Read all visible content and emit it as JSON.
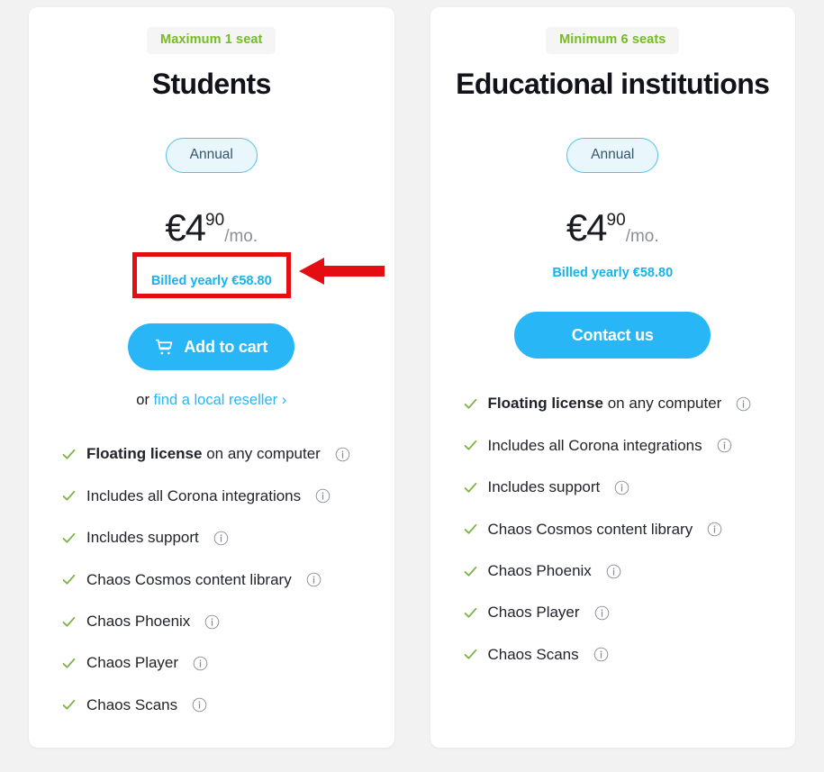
{
  "theme": {
    "page_bg": "#f2f2f2",
    "card_bg": "#ffffff",
    "accent_blue": "#29b6f6",
    "link_blue": "#17b3ec",
    "badge_green": "#76bc21",
    "check_green": "#7cb342",
    "annotation_red": "#e40d12",
    "title_color": "#12131a"
  },
  "plans": [
    {
      "id": "students",
      "badge": "Maximum 1 seat",
      "title": "Students",
      "term": "Annual",
      "price": {
        "currency_amount": "€4",
        "cents": "90",
        "period": "/mo."
      },
      "billed_note": "Billed yearly €58.80",
      "billed_highlighted": true,
      "cta": {
        "label": "Add to cart",
        "icon": "shopping-cart-icon",
        "has_icon": true
      },
      "reseller": {
        "prefix": "or",
        "link_label": "find a local reseller",
        "chevron": "›"
      },
      "features": [
        {
          "bold": "Floating license",
          "rest": " on any computer",
          "info": "info-icon"
        },
        {
          "bold": "",
          "rest": "Includes all Corona integrations",
          "info": "info-icon"
        },
        {
          "bold": "",
          "rest": "Includes support",
          "info": "info-icon"
        },
        {
          "bold": "",
          "rest": "Chaos Cosmos content library",
          "info": "info-icon"
        },
        {
          "bold": "",
          "rest": "Chaos Phoenix",
          "info": "info-icon"
        },
        {
          "bold": "",
          "rest": "Chaos Player",
          "info": "info-icon"
        },
        {
          "bold": "",
          "rest": "Chaos Scans",
          "info": "info-icon"
        }
      ]
    },
    {
      "id": "educational-institutions",
      "badge": "Minimum 6 seats",
      "title": "Educational institutions",
      "term": "Annual",
      "price": {
        "currency_amount": "€4",
        "cents": "90",
        "period": "/mo."
      },
      "billed_note": "Billed yearly €58.80",
      "billed_highlighted": false,
      "cta": {
        "label": "Contact us",
        "icon": "",
        "has_icon": false
      },
      "reseller": null,
      "features": [
        {
          "bold": "Floating license",
          "rest": " on any computer",
          "info": "info-icon"
        },
        {
          "bold": "",
          "rest": "Includes all Corona integrations",
          "info": "info-icon"
        },
        {
          "bold": "",
          "rest": "Includes support",
          "info": "info-icon"
        },
        {
          "bold": "",
          "rest": "Chaos Cosmos content library",
          "info": "info-icon"
        },
        {
          "bold": "",
          "rest": "Chaos Phoenix",
          "info": "info-icon"
        },
        {
          "bold": "",
          "rest": "Chaos Player",
          "info": "info-icon"
        },
        {
          "bold": "",
          "rest": "Chaos Scans",
          "info": "info-icon"
        }
      ]
    }
  ],
  "annotation": {
    "type": "arrow-left",
    "color": "#e40d12",
    "points_to": "billed-yearly-note-students"
  }
}
